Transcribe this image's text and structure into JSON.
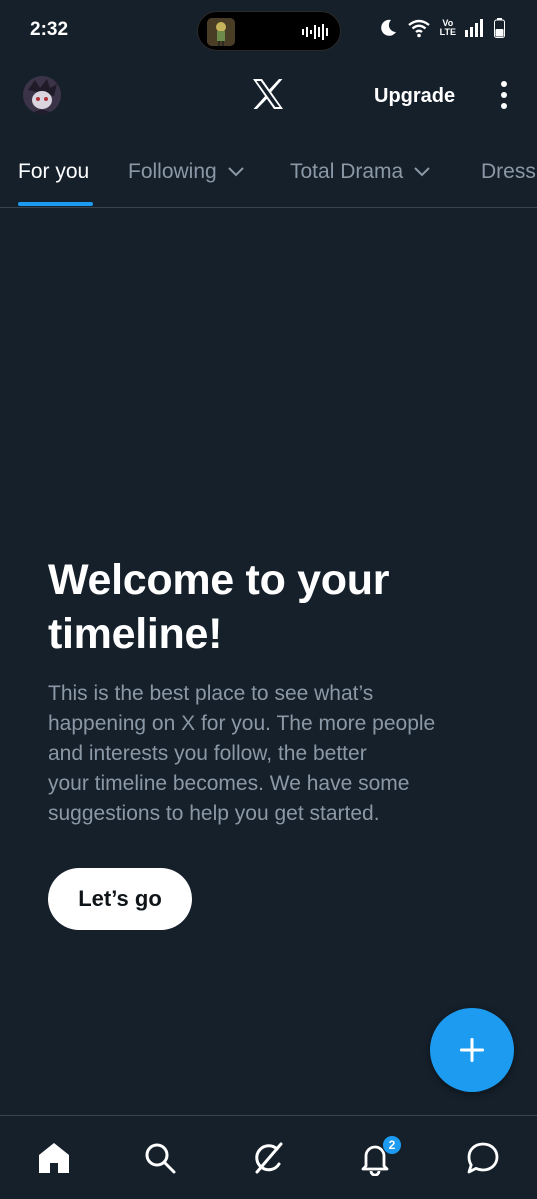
{
  "status_bar": {
    "time": "2:32",
    "network_label_top": "Vo",
    "network_label_bottom": "LTE"
  },
  "header": {
    "upgrade_label": "Upgrade"
  },
  "tabs": [
    {
      "label": "For you",
      "active": true
    },
    {
      "label": "Following",
      "active": false
    },
    {
      "label": "Total Drama",
      "active": false
    },
    {
      "label": "Dress",
      "active": false
    }
  ],
  "welcome": {
    "title_line1": "Welcome to your",
    "title_line2": "timeline!",
    "body_line1": "This is the best place to see what’s",
    "body_line2": "happening on X for you. The more people",
    "body_line3": "and interests you follow, the better",
    "body_line4": "your timeline becomes. We have some",
    "body_line5": "suggestions to help you get started.",
    "button_label": "Let’s go"
  },
  "notifications": {
    "badge_count": "2"
  },
  "icons": {
    "home": "home-icon",
    "search": "search-icon",
    "grok": "grok-icon",
    "notifications": "bell-icon",
    "messages": "chat-bubble-icon",
    "compose": "plus-icon"
  },
  "colors": {
    "background": "#15202b",
    "accent": "#1d9bf0",
    "secondary_text": "#8b98a5"
  }
}
